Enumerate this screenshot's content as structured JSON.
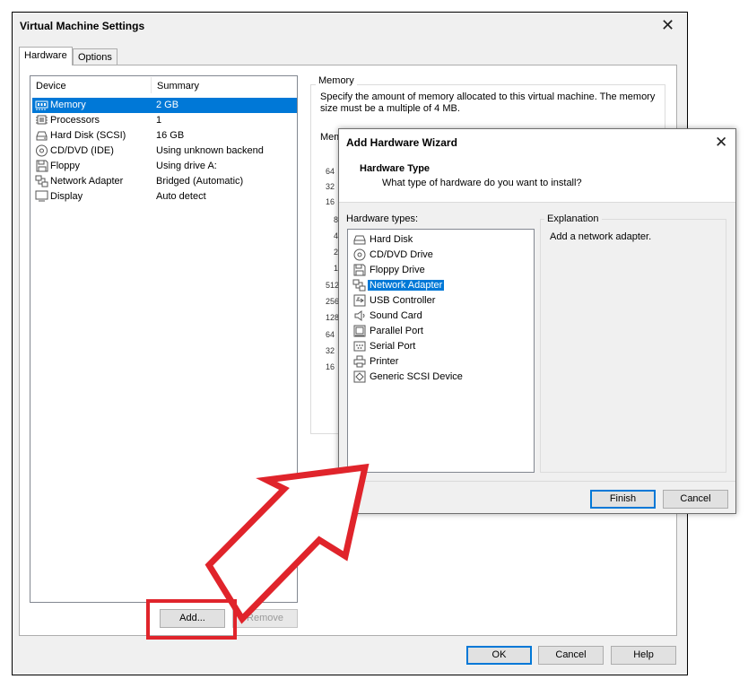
{
  "window": {
    "title": "Virtual Machine Settings",
    "close_glyph": "✕",
    "tabs": [
      {
        "label": "Hardware"
      },
      {
        "label": "Options"
      }
    ]
  },
  "device_list": {
    "headers": {
      "device": "Device",
      "summary": "Summary"
    },
    "rows": [
      {
        "icon": "memory-icon",
        "name": "Memory",
        "summary": "2 GB",
        "selected": true
      },
      {
        "icon": "processor-icon",
        "name": "Processors",
        "summary": "1"
      },
      {
        "icon": "hard-disk-icon",
        "name": "Hard Disk (SCSI)",
        "summary": "16 GB"
      },
      {
        "icon": "cd-dvd-icon",
        "name": "CD/DVD (IDE)",
        "summary": "Using unknown backend"
      },
      {
        "icon": "floppy-icon",
        "name": "Floppy",
        "summary": "Using drive A:"
      },
      {
        "icon": "network-adapter-icon",
        "name": "Network Adapter",
        "summary": "Bridged (Automatic)"
      },
      {
        "icon": "display-icon",
        "name": "Display",
        "summary": "Auto detect"
      }
    ]
  },
  "memory_panel": {
    "legend": "Memory",
    "description": "Specify the amount of memory allocated to this virtual machine. The memory size must be a multiple of 4 MB.",
    "label_partial": "Mem",
    "ticks": [
      "64",
      "32",
      "16",
      "8",
      "4",
      "2",
      "1",
      "512",
      "256",
      "128",
      "64",
      "32",
      "16"
    ]
  },
  "buttons": {
    "add": "Add...",
    "remove": "Remove",
    "ok": "OK",
    "cancel": "Cancel",
    "help": "Help"
  },
  "wizard": {
    "title": "Add Hardware Wizard",
    "close_glyph": "✕",
    "heading": "Hardware Type",
    "subheading": "What type of hardware do you want to install?",
    "types_label": "Hardware types:",
    "types": [
      {
        "icon": "hard-disk-icon",
        "label": "Hard Disk"
      },
      {
        "icon": "cd-dvd-icon",
        "label": "CD/DVD Drive"
      },
      {
        "icon": "floppy-icon",
        "label": "Floppy Drive"
      },
      {
        "icon": "network-adapter-icon",
        "label": "Network Adapter",
        "selected": true
      },
      {
        "icon": "usb-icon",
        "label": "USB Controller"
      },
      {
        "icon": "sound-icon",
        "label": "Sound Card"
      },
      {
        "icon": "parallel-port-icon",
        "label": "Parallel Port"
      },
      {
        "icon": "serial-port-icon",
        "label": "Serial Port"
      },
      {
        "icon": "printer-icon",
        "label": "Printer"
      },
      {
        "icon": "scsi-icon",
        "label": "Generic SCSI Device"
      }
    ],
    "explanation_legend": "Explanation",
    "explanation_text": "Add a network adapter.",
    "finish": "Finish",
    "cancel": "Cancel"
  },
  "annotation": {
    "color": "#e0242b"
  },
  "colors": {
    "selection": "#0078d7",
    "window_bg": "#f0f0f0"
  }
}
